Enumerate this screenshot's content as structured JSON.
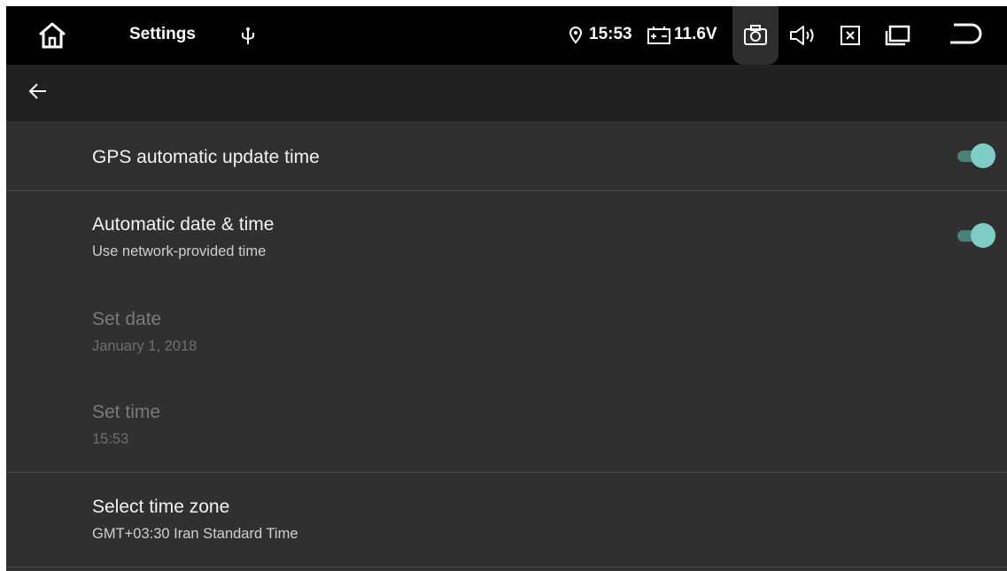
{
  "status_bar": {
    "app_title": "Settings",
    "time": "15:53",
    "voltage": "11.6V",
    "icons": [
      "home-icon",
      "usb-icon",
      "location-icon",
      "battery-icon",
      "camera-icon",
      "volume-icon",
      "close-icon",
      "recent-apps-icon",
      "back-icon"
    ]
  },
  "toolbar": {
    "back_icon": "arrow-back-icon"
  },
  "settings": [
    {
      "id": "gps-update",
      "title": "GPS automatic update time",
      "summary": "",
      "toggle": true,
      "enabled": true
    },
    {
      "id": "auto-datetime",
      "title": "Automatic date & time",
      "summary": "Use network-provided time",
      "toggle": true,
      "enabled": true
    },
    {
      "id": "set-date",
      "title": "Set date",
      "summary": "January 1, 2018",
      "enabled": false
    },
    {
      "id": "set-time",
      "title": "Set time",
      "summary": "15:53",
      "enabled": false
    },
    {
      "id": "time-zone",
      "title": "Select time zone",
      "summary": "GMT+03:30 Iran Standard Time",
      "enabled": true
    }
  ],
  "colors": {
    "accent": "#80cbc4",
    "background": "#303030",
    "toolbar": "#212121",
    "status_bar": "#000000"
  }
}
